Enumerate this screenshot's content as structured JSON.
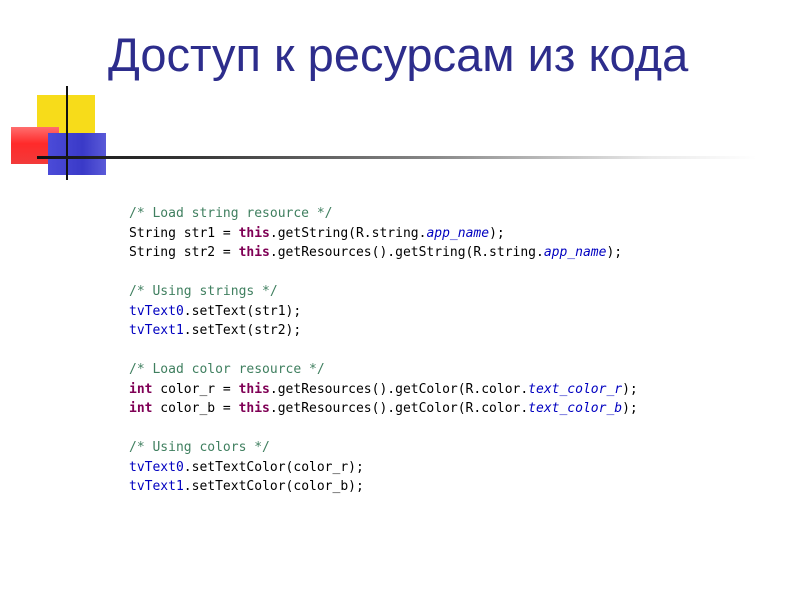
{
  "slide": {
    "title": "Доступ к ресурсам из кода",
    "colors": {
      "title": "#2d2d8c",
      "comment": "#3f7f5f",
      "keyword": "#7f0055",
      "field": "#0000c0",
      "accent_yellow": "#f7dc1a",
      "accent_red": "#ff2a2a",
      "accent_blue": "#3a3ac8"
    }
  },
  "code": {
    "lines": [
      {
        "id": "l1",
        "tokens": [
          {
            "t": "comment",
            "v": "/* Load string resource */"
          }
        ]
      },
      {
        "id": "l2",
        "tokens": [
          {
            "t": "plain",
            "v": "String str1 = "
          },
          {
            "t": "kw",
            "v": "this"
          },
          {
            "t": "plain",
            "v": ".getString(R.string."
          },
          {
            "t": "field",
            "v": "app_name"
          },
          {
            "t": "plain",
            "v": ");"
          }
        ]
      },
      {
        "id": "l3",
        "tokens": [
          {
            "t": "plain",
            "v": "String str2 = "
          },
          {
            "t": "kw",
            "v": "this"
          },
          {
            "t": "plain",
            "v": ".getResources().getString(R.string."
          },
          {
            "t": "field",
            "v": "app_name"
          },
          {
            "t": "plain",
            "v": ");"
          }
        ]
      },
      {
        "id": "l4",
        "tokens": []
      },
      {
        "id": "l5",
        "tokens": [
          {
            "t": "comment",
            "v": "/* Using strings */"
          }
        ]
      },
      {
        "id": "l6",
        "tokens": [
          {
            "t": "var",
            "v": "tvText0"
          },
          {
            "t": "plain",
            "v": ".setText(str1);"
          }
        ]
      },
      {
        "id": "l7",
        "tokens": [
          {
            "t": "var",
            "v": "tvText1"
          },
          {
            "t": "plain",
            "v": ".setText(str2);"
          }
        ]
      },
      {
        "id": "l8",
        "tokens": []
      },
      {
        "id": "l9",
        "tokens": [
          {
            "t": "comment",
            "v": "/* Load color resource */"
          }
        ]
      },
      {
        "id": "l10",
        "tokens": [
          {
            "t": "kw",
            "v": "int"
          },
          {
            "t": "plain",
            "v": " color_r = "
          },
          {
            "t": "kw",
            "v": "this"
          },
          {
            "t": "plain",
            "v": ".getResources().getColor(R.color."
          },
          {
            "t": "field",
            "v": "text_color_r"
          },
          {
            "t": "plain",
            "v": ");"
          }
        ]
      },
      {
        "id": "l11",
        "tokens": [
          {
            "t": "kw",
            "v": "int"
          },
          {
            "t": "plain",
            "v": " color_b = "
          },
          {
            "t": "kw",
            "v": "this"
          },
          {
            "t": "plain",
            "v": ".getResources().getColor(R.color."
          },
          {
            "t": "field",
            "v": "text_color_b"
          },
          {
            "t": "plain",
            "v": ");"
          }
        ]
      },
      {
        "id": "l12",
        "tokens": []
      },
      {
        "id": "l13",
        "tokens": [
          {
            "t": "comment",
            "v": "/* Using colors */"
          }
        ]
      },
      {
        "id": "l14",
        "tokens": [
          {
            "t": "var",
            "v": "tvText0"
          },
          {
            "t": "plain",
            "v": ".setTextColor(color_r);"
          }
        ]
      },
      {
        "id": "l15",
        "tokens": [
          {
            "t": "var",
            "v": "tvText1"
          },
          {
            "t": "plain",
            "v": ".setTextColor(color_b);"
          }
        ]
      }
    ]
  }
}
